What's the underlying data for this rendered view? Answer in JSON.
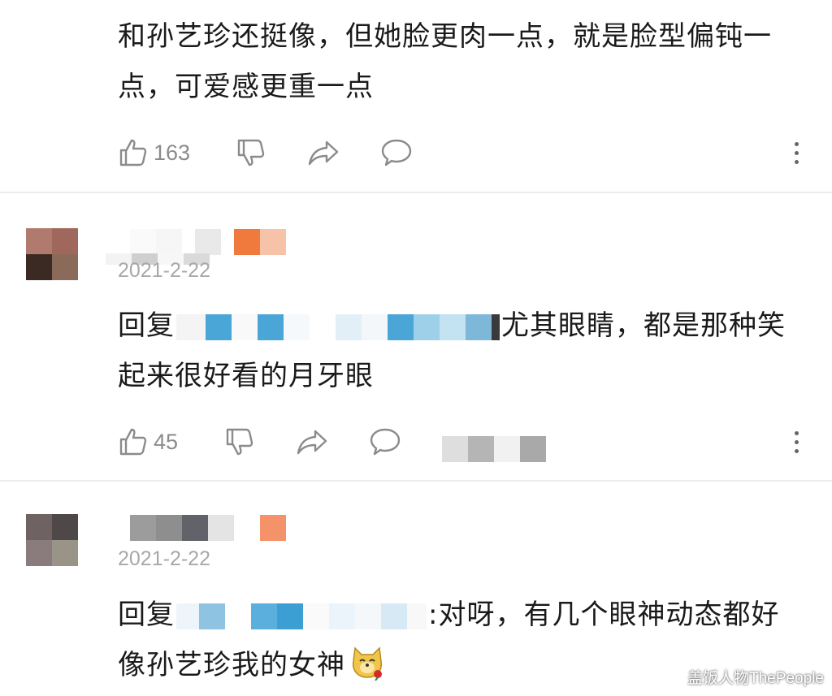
{
  "comments": [
    {
      "text": "和孙艺珍还挺像，但她脸更肉一点，就是脸型偏钝一点，可爱感更重一点",
      "likes": "163"
    },
    {
      "date": "2021-2-22",
      "reply_prefix": "回复",
      "text": "尤其眼睛，都是那种笑起来很好看的月牙眼",
      "likes": "45"
    },
    {
      "date": "2021-2-22",
      "reply_prefix": "回复",
      "text": ":对呀，有几个眼神动态都好像孙艺珍我的女神"
    }
  ],
  "icons": {
    "like": "thumbs-up-icon",
    "dislike": "thumbs-down-icon",
    "share": "share-arrow-icon",
    "reply": "comment-bubble-icon",
    "more": "more-vertical-icon",
    "emoji": "dog-face-with-rose-emoji"
  },
  "watermark": "盖饭人物ThePeople",
  "colors": {
    "action_gray": "#8b8b8b",
    "date_gray": "#a8a8a8",
    "divider": "#ececec",
    "level_badge_orange": "#f07a3e"
  }
}
